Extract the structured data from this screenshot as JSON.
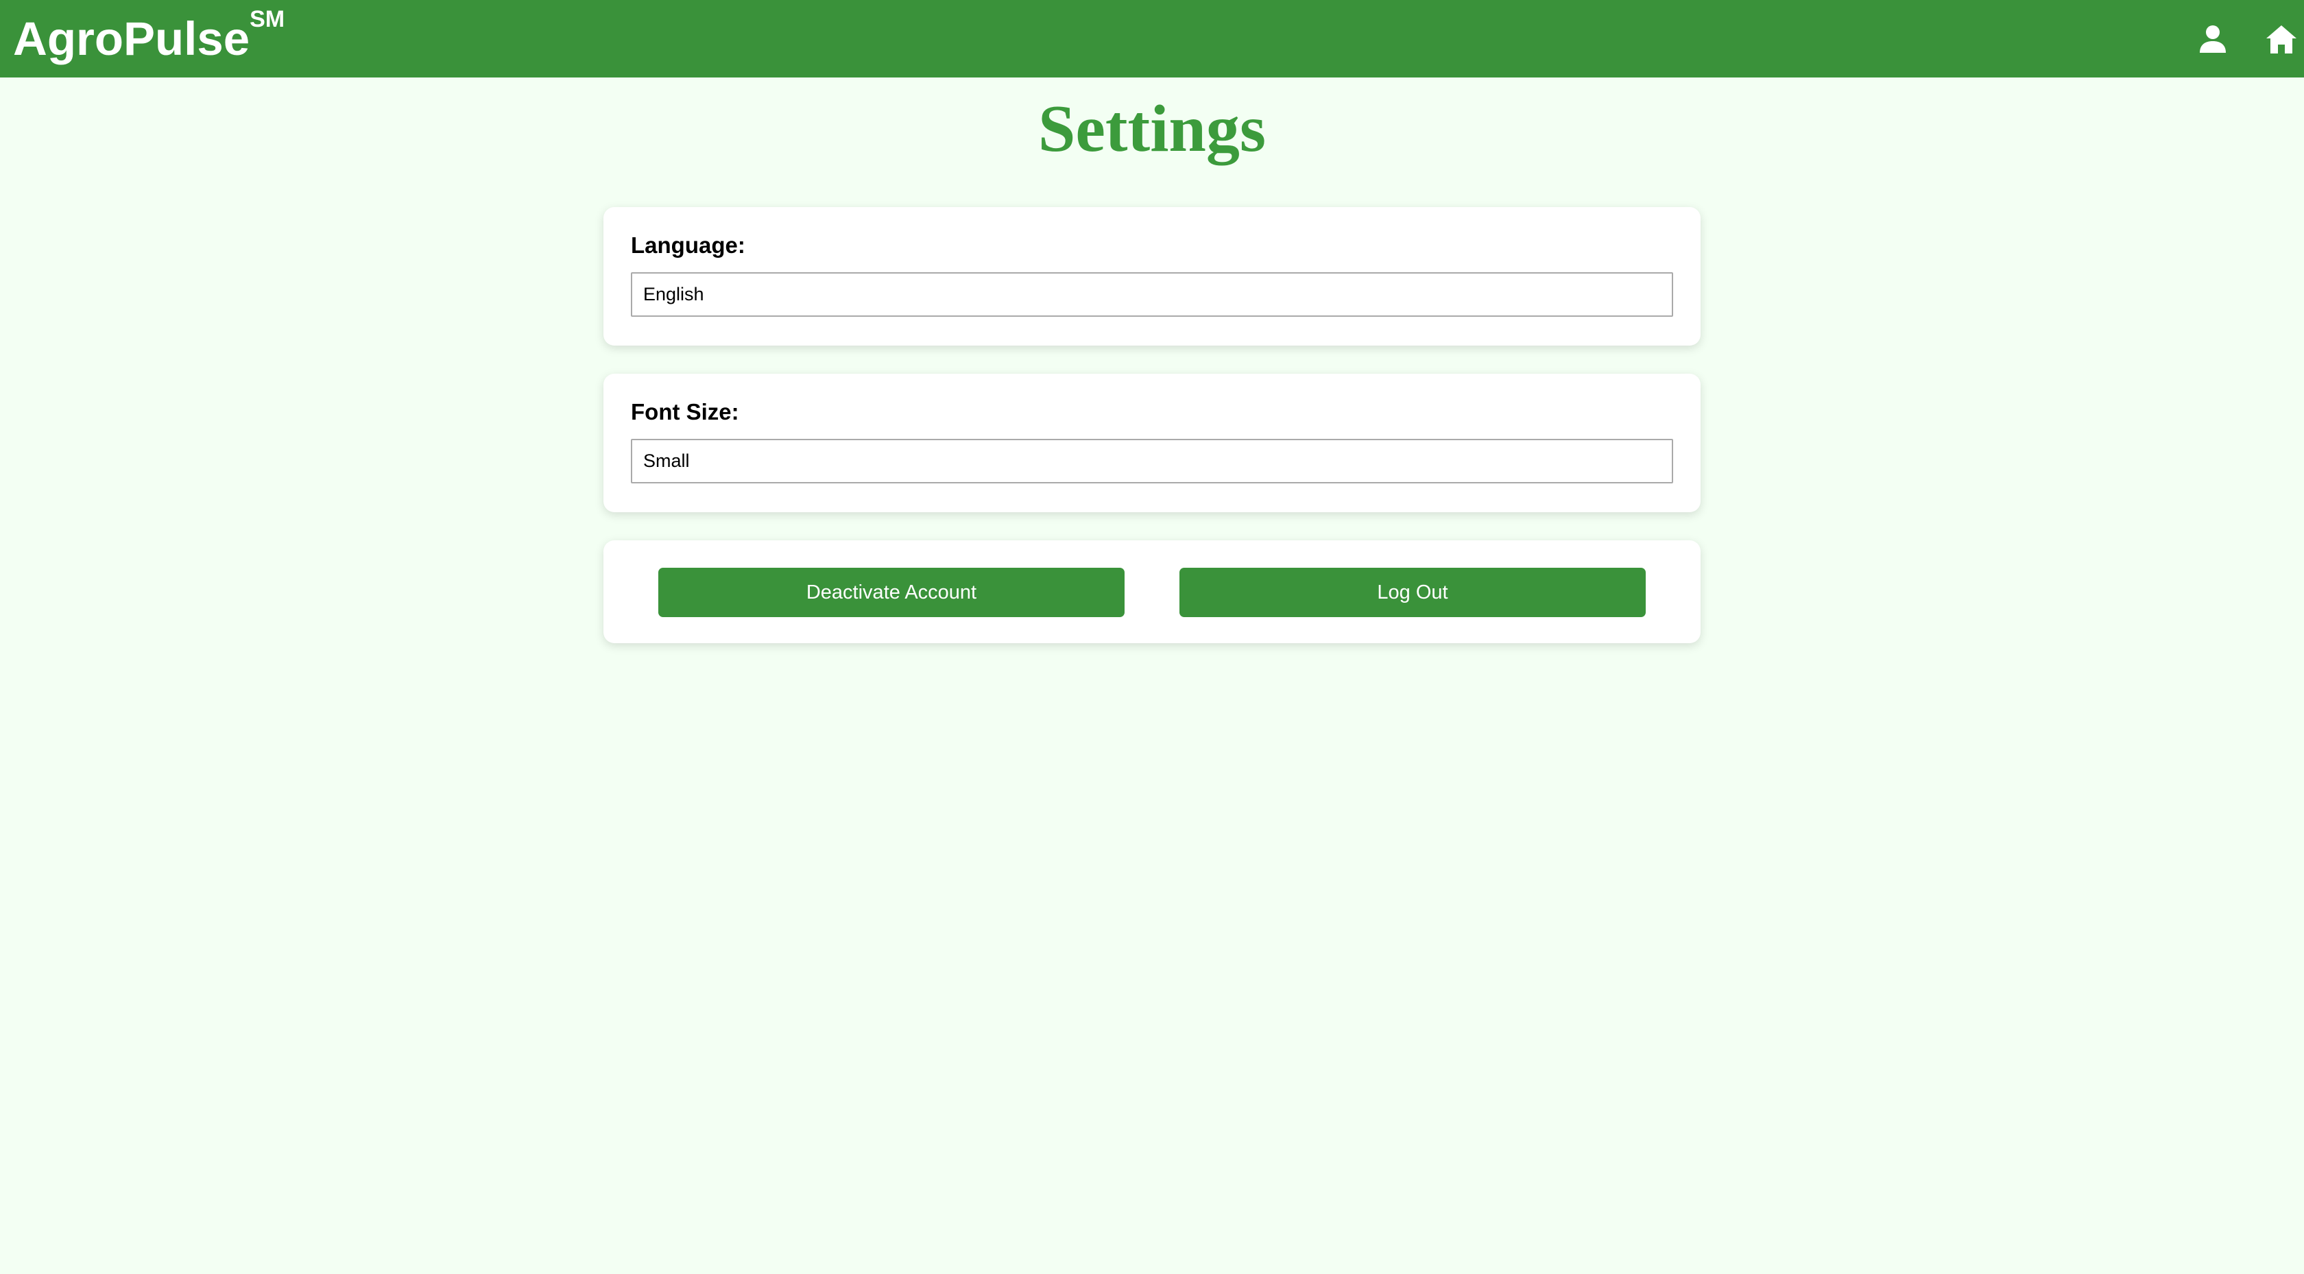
{
  "header": {
    "brand": "AgroPulse",
    "brand_mark": "SM",
    "icons": {
      "profile": "user-icon",
      "home": "home-icon"
    },
    "background_color": "#3a923a"
  },
  "page": {
    "title": "Settings",
    "title_color": "#3c9b3c",
    "background_color": "#f3fff3"
  },
  "settings": {
    "language": {
      "label": "Language:",
      "value": "English"
    },
    "font_size": {
      "label": "Font Size:",
      "value": "Small"
    }
  },
  "actions": {
    "deactivate_label": "Deactivate Account",
    "logout_label": "Log Out"
  }
}
